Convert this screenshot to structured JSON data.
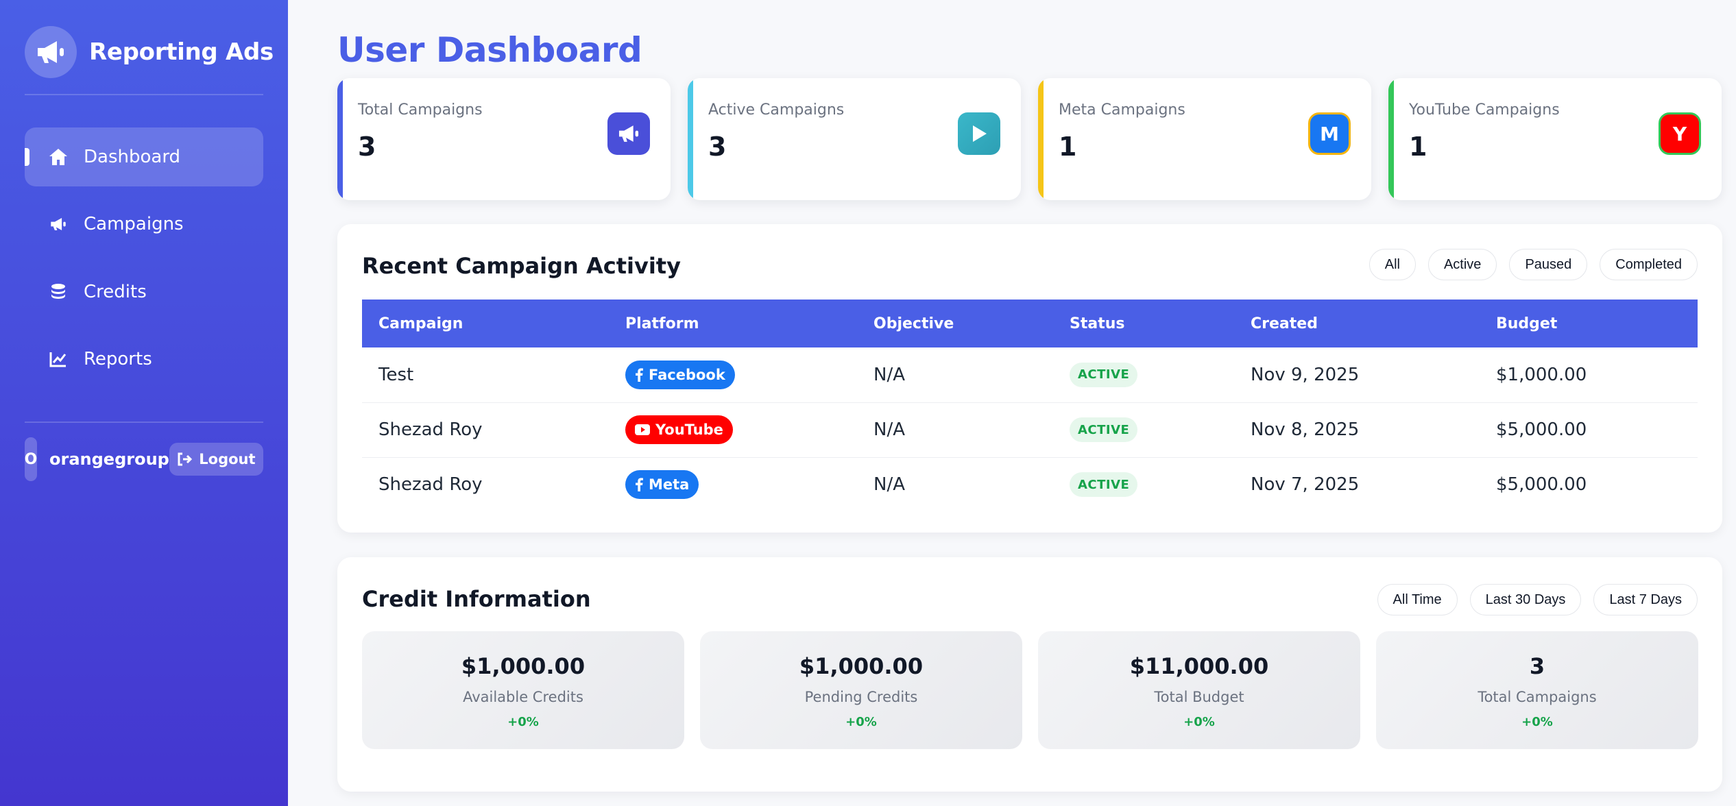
{
  "sidebar": {
    "brand": "Reporting Ads",
    "nav": [
      {
        "label": "Dashboard",
        "icon": "home-icon"
      },
      {
        "label": "Campaigns",
        "icon": "megaphone-icon"
      },
      {
        "label": "Credits",
        "icon": "coins-icon"
      },
      {
        "label": "Reports",
        "icon": "line-chart-icon"
      }
    ],
    "user": {
      "avatar_initial": "O",
      "name": "orangegroup"
    },
    "logout_label": "Logout"
  },
  "page_title": "User Dashboard",
  "stats": [
    {
      "label": "Total Campaigns",
      "value": "3",
      "color": "#4a5fe6",
      "icon": "megaphone-icon"
    },
    {
      "label": "Active Campaigns",
      "value": "3",
      "color": "#4cc9e8",
      "icon": "play-icon"
    },
    {
      "label": "Meta Campaigns",
      "value": "1",
      "color": "#f5c518",
      "icon": "meta-icon",
      "icon_text": "M"
    },
    {
      "label": "YouTube Campaigns",
      "value": "1",
      "color": "#34c759",
      "icon": "youtube-icon",
      "icon_text": "Y"
    }
  ],
  "recent": {
    "title": "Recent Campaign Activity",
    "filters": [
      "All",
      "Active",
      "Paused",
      "Completed"
    ],
    "columns": [
      "Campaign",
      "Platform",
      "Objective",
      "Status",
      "Created",
      "Budget"
    ],
    "rows": [
      {
        "campaign": "Test",
        "platform": "Facebook",
        "platform_color": "#1877f2",
        "objective": "N/A",
        "status": "ACTIVE",
        "created": "Nov 9, 2025",
        "budget": "$1,000.00"
      },
      {
        "campaign": "Shezad Roy",
        "platform": "YouTube",
        "platform_color": "#ff0000",
        "objective": "N/A",
        "status": "ACTIVE",
        "created": "Nov 8, 2025",
        "budget": "$5,000.00"
      },
      {
        "campaign": "Shezad Roy",
        "platform": "Meta",
        "platform_color": "#1877f2",
        "objective": "N/A",
        "status": "ACTIVE",
        "created": "Nov 7, 2025",
        "budget": "$5,000.00"
      }
    ]
  },
  "credits": {
    "title": "Credit Information",
    "filters": [
      "All Time",
      "Last 30 Days",
      "Last 7 Days"
    ],
    "items": [
      {
        "value": "$1,000.00",
        "label": "Available Credits",
        "change": "+0%"
      },
      {
        "value": "$1,000.00",
        "label": "Pending Credits",
        "change": "+0%"
      },
      {
        "value": "$11,000.00",
        "label": "Total Budget",
        "change": "+0%"
      },
      {
        "value": "3",
        "label": "Total Campaigns",
        "change": "+0%"
      }
    ]
  }
}
